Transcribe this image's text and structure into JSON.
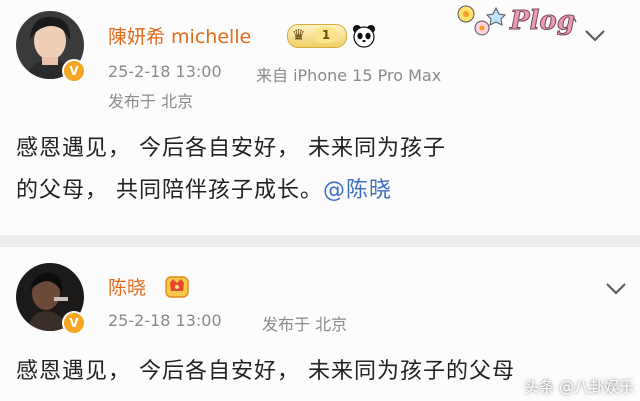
{
  "post1": {
    "author_name": "陳妍希 michelle",
    "level_badge": "1",
    "timestamp": "25-2-18 13:00",
    "device": "来自 iPhone 15 Pro Max",
    "location": "发布于 北京",
    "body_line1": "感恩遇见， 今后各自安好， 未来同为孩子",
    "body_line2": "的父母， 共同陪伴孩子成长。",
    "mention": "@陈晓",
    "sticker_text": "Plog",
    "icons": [
      "verified-badge-icon",
      "crown-badge-icon",
      "panda-emoji-icon",
      "chevron-down-icon"
    ]
  },
  "post2": {
    "author_name": "陈晓",
    "timestamp": "25-2-18 13:00",
    "location": "发布于 北京",
    "body_line1": "感恩遇见， 今后各自安好， 未来同为孩子的父母",
    "icons": [
      "verified-badge-icon",
      "vip-badge-icon",
      "chevron-down-icon"
    ]
  },
  "watermark": "头条 @八卦娱乐",
  "colors": {
    "name": "#e26a1b",
    "meta": "#8a8a8a",
    "mention": "#3b6fc4",
    "verified": "#f5a623"
  }
}
